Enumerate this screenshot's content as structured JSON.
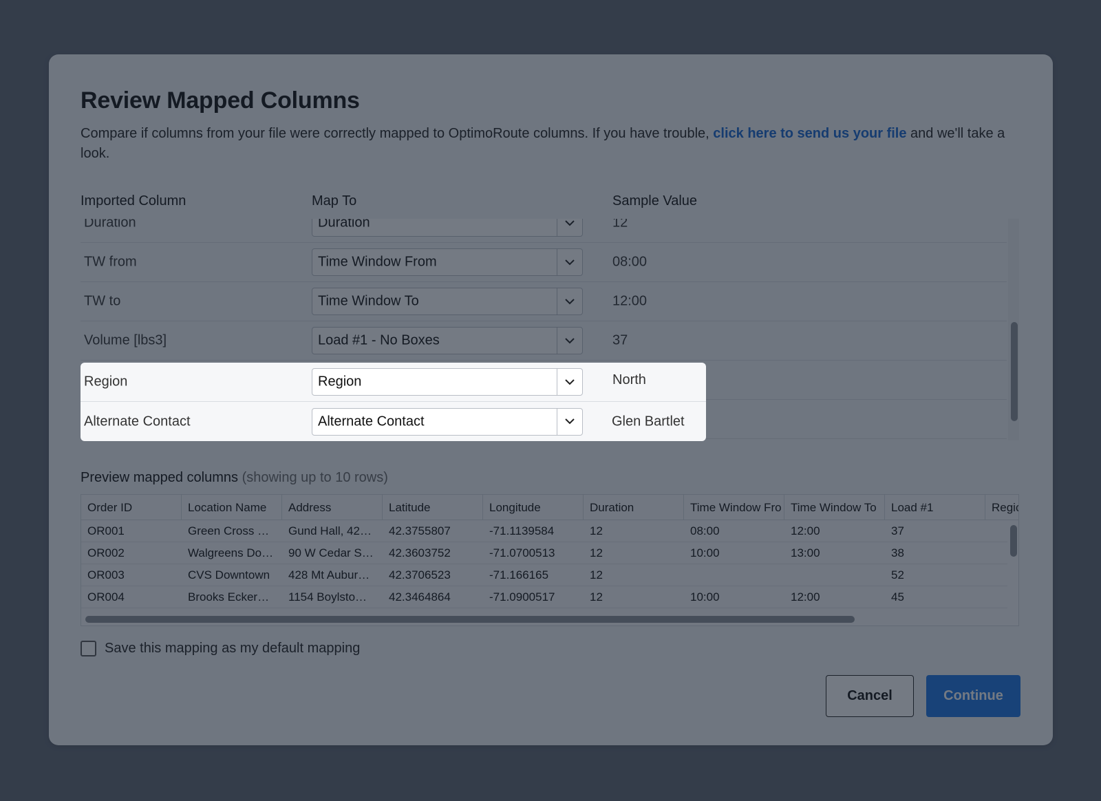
{
  "dialog": {
    "title": "Review Mapped Columns",
    "description_before": "Compare if columns from your file were correctly mapped to OptimoRoute columns. If you have trouble, ",
    "description_link": "click here to send us your file",
    "description_after": " and we'll take a look."
  },
  "mapping": {
    "headers": {
      "imported": "Imported Column",
      "map_to": "Map To",
      "sample": "Sample Value"
    },
    "rows": [
      {
        "imported": "Duration",
        "map_to": "Duration",
        "sample": "12"
      },
      {
        "imported": "TW from",
        "map_to": "Time Window From",
        "sample": "08:00"
      },
      {
        "imported": "TW to",
        "map_to": "Time Window To",
        "sample": "12:00"
      },
      {
        "imported": "Volume [lbs3]",
        "map_to": "Load #1 - No Boxes",
        "sample": "37"
      },
      {
        "imported": "Region",
        "map_to": "Region",
        "sample": "North"
      },
      {
        "imported": "Alternate Contact",
        "map_to": "Alternate Contact",
        "sample": "Glen Bartlet"
      }
    ]
  },
  "preview": {
    "title": "Preview mapped columns",
    "subtitle": "(showing up to 10 rows)",
    "columns": [
      "Order ID",
      "Location Name",
      "Address",
      "Latitude",
      "Longitude",
      "Duration",
      "Time Window Fro",
      "Time Window To",
      "Load #1",
      "Regic"
    ],
    "rows": [
      [
        "OR001",
        "Green Cross …",
        "Gund Hall, 42…",
        "42.3755807",
        "-71.1139584",
        "12",
        "08:00",
        "12:00",
        "37"
      ],
      [
        "OR002",
        "Walgreens Do…",
        "90 W Cedar S…",
        "42.3603752",
        "-71.0700513",
        "12",
        "10:00",
        "13:00",
        "38"
      ],
      [
        "OR003",
        "CVS Downtown",
        "428 Mt Aubur…",
        "42.3706523",
        "-71.166165",
        "12",
        "",
        "",
        "52"
      ],
      [
        "OR004",
        "Brooks Ecker…",
        "1154 Boylsto…",
        "42.3464864",
        "-71.0900517",
        "12",
        "10:00",
        "12:00",
        "45"
      ]
    ]
  },
  "default_mapping": {
    "label": "Save this mapping as my default mapping",
    "checked": false
  },
  "buttons": {
    "cancel": "Cancel",
    "continue": "Continue"
  }
}
